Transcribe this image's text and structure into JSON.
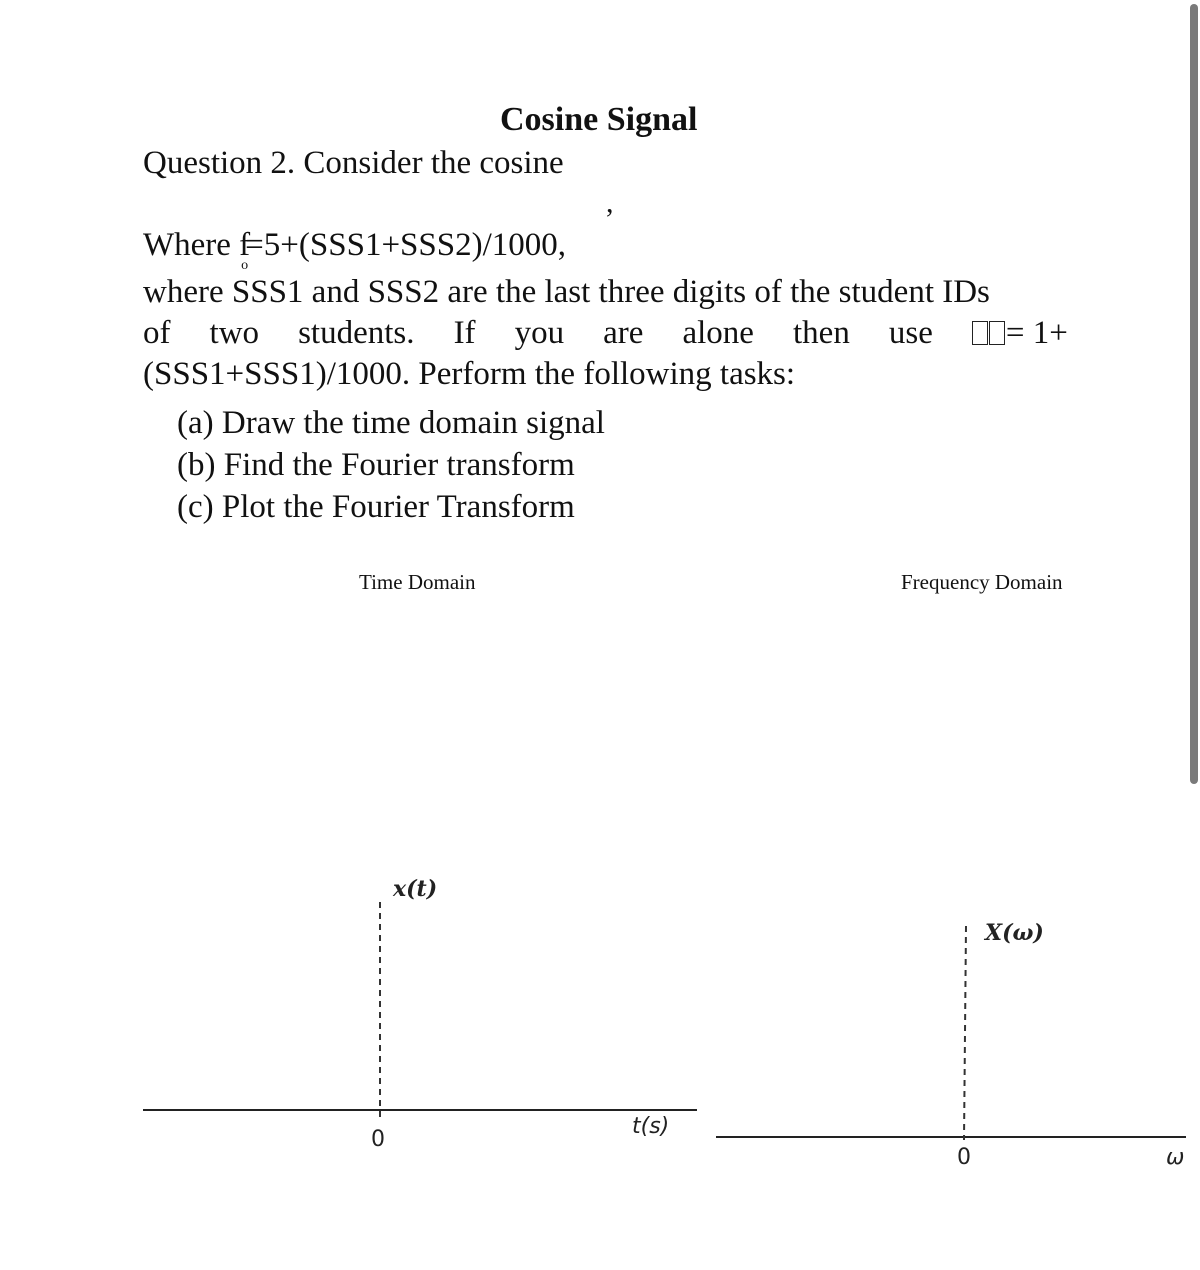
{
  "document": {
    "title": "Cosine Signal",
    "question_line": "Question 2.  Consider the cosine",
    "stray_comma": ",",
    "where_prefix": "Where f",
    "where_subscript": "o",
    "where_rest": "=5+(SSS1+SSS2)/1000,",
    "paragraph": {
      "line1": "where SSS1 and SSS2 are the last three digits of the student IDs",
      "line2_words": [
        "of",
        "two",
        "students.",
        "If",
        "you",
        "are",
        "alone",
        "then",
        "use"
      ],
      "line2_tail": "= 1+",
      "line2_missing_glyphs": 2,
      "line3": "(SSS1+SSS1)/1000. Perform the following tasks:"
    },
    "tasks": [
      "(a) Draw the time domain signal",
      "(b) Find the Fourier transform",
      "(c) Plot the Fourier Transform"
    ]
  },
  "plots": {
    "time": {
      "heading": "Time Domain",
      "y_label": "x(t)",
      "x_label": "t(s)",
      "origin_label": "0"
    },
    "frequency": {
      "heading": "Frequency Domain",
      "y_label": "X(ω)",
      "x_label": "ω (",
      "origin_label": "0"
    }
  },
  "colors": {
    "text": "#111111",
    "axis": "#222222",
    "scrollbar_thumb": "#7a7a7a"
  }
}
